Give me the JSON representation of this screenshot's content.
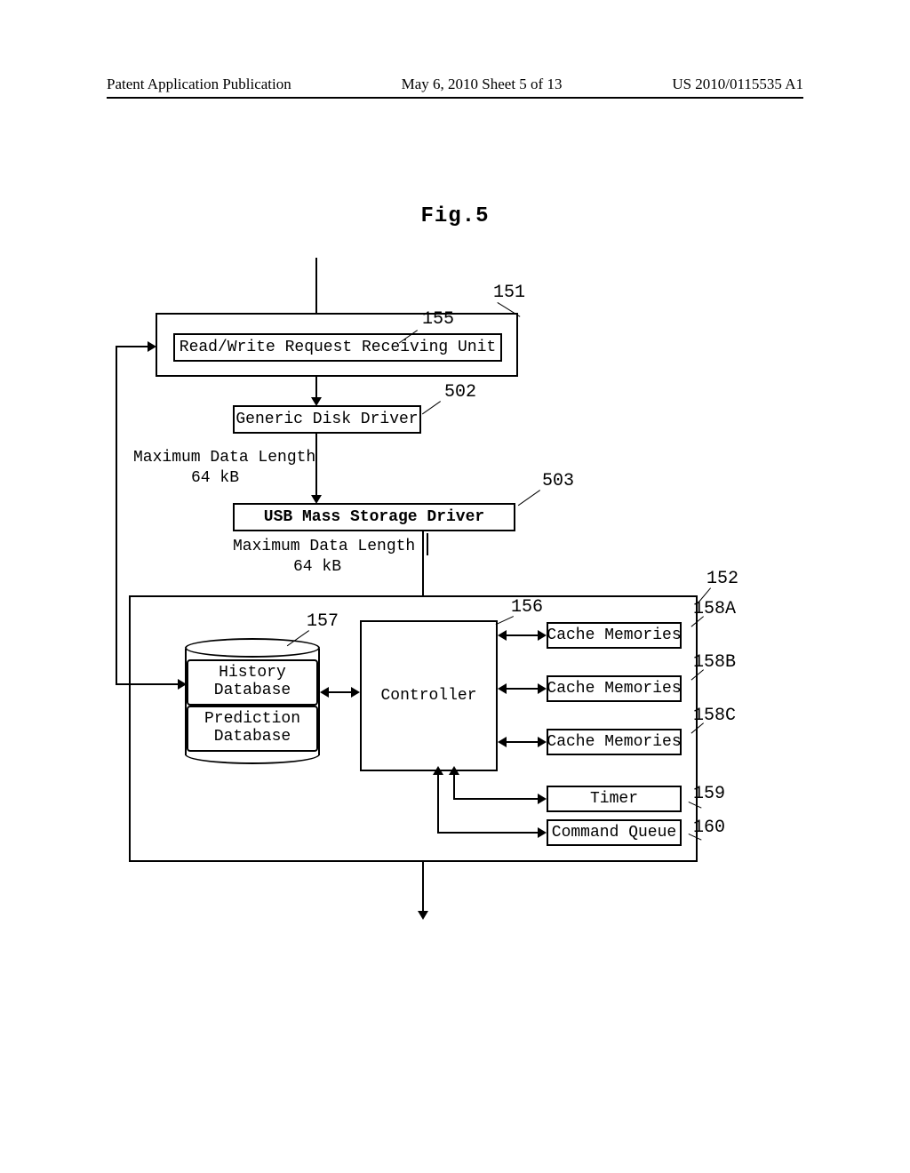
{
  "header": {
    "left": "Patent Application Publication",
    "mid": "May 6, 2010  Sheet 5 of 13",
    "right": "US 2010/0115535 A1"
  },
  "fig_label": "Fig.5",
  "blocks": {
    "rw_unit": "Read/Write Request Receiving Unit",
    "generic_driver": "Generic Disk Driver",
    "usb_driver": "USB Mass Storage Driver",
    "controller": "Controller",
    "history_db": "History\nDatabase",
    "prediction_db": "Prediction\nDatabase",
    "cache_a": "Cache Memories",
    "cache_b": "Cache Memories",
    "cache_c": "Cache Memories",
    "timer": "Timer",
    "command_queue": "Command Queue"
  },
  "labels": {
    "max_len_1": "Maximum Data Length",
    "max_len_val_1": "64 kB",
    "max_len_2": "Maximum Data Length",
    "max_len_val_2": "64 kB"
  },
  "refs": {
    "r151": "151",
    "r155": "155",
    "r502": "502",
    "r503": "503",
    "r152": "152",
    "r156": "156",
    "r157": "157",
    "r158A": "158A",
    "r158B": "158B",
    "r158C": "158C",
    "r159": "159",
    "r160": "160"
  }
}
